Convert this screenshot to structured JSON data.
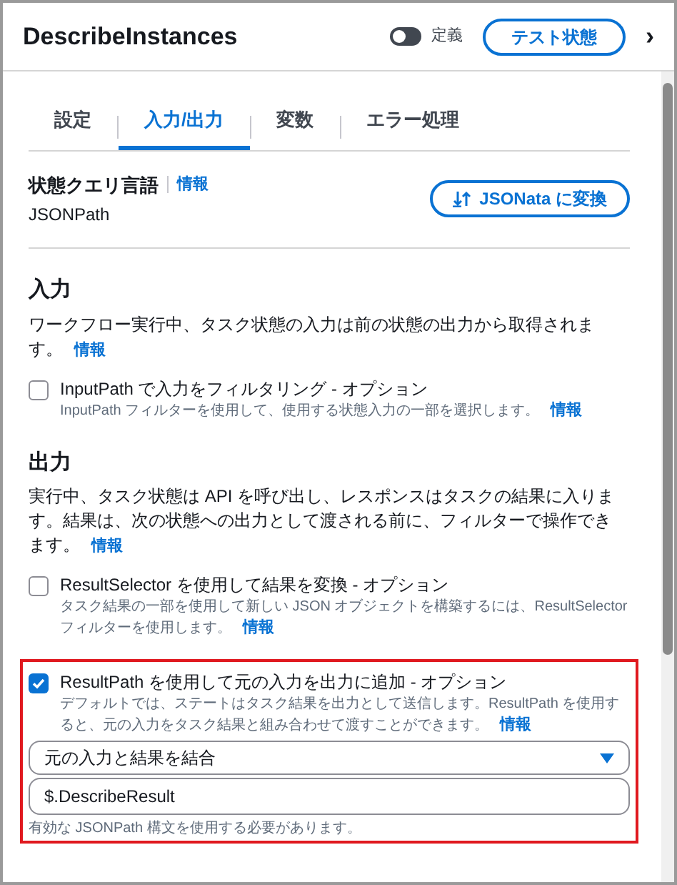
{
  "header": {
    "title": "DescribeInstances",
    "toggle": {
      "label": "定義",
      "on": false
    },
    "test_button": "テスト状態",
    "next": "›"
  },
  "tabs": [
    {
      "label": "設定",
      "selected": false
    },
    {
      "label": "入力/出力",
      "selected": true
    },
    {
      "label": "変数",
      "selected": false
    },
    {
      "label": "エラー処理",
      "selected": false
    }
  ],
  "query_language": {
    "title": "状態クエリ言語",
    "info": "情報",
    "value": "JSONPath",
    "convert_button": "JSONata に変換"
  },
  "sections": [
    {
      "title": "入力",
      "description": "ワークフロー実行中、タスク状態の入力は前の状態の出力から取得されます。",
      "info": "情報",
      "options": [
        {
          "label": "InputPath で入力をフィルタリング - オプション",
          "description": "InputPath フィルターを使用して、使用する状態入力の一部を選択します。",
          "info": "情報",
          "checked": false,
          "highlighted": false
        }
      ]
    },
    {
      "title": "出力",
      "description": "実行中、タスク状態は API を呼び出し、レスポンスはタスクの結果に入ります。結果は、次の状態への出力として渡される前に、フィルターで操作できます。",
      "info": "情報",
      "options": [
        {
          "label": "ResultSelector を使用して結果を変換 - オプション",
          "description": "タスク結果の一部を使用して新しい JSON オブジェクトを構築するには、ResultSelector フィルターを使用します。",
          "info": "情報",
          "checked": false,
          "highlighted": false
        },
        {
          "label": "ResultPath を使用して元の入力を出力に追加 - オプション",
          "description": "デフォルトでは、ステートはタスク結果を出力として送信します。ResultPath を使用すると、元の入力をタスク結果と組み合わせて渡すことができます。",
          "info": "情報",
          "checked": true,
          "highlighted": true,
          "select": "元の入力と結果を結合",
          "input": "$.DescribeResult",
          "hint": "有効な JSONPath 構文を使用する必要があります。"
        }
      ]
    }
  ]
}
